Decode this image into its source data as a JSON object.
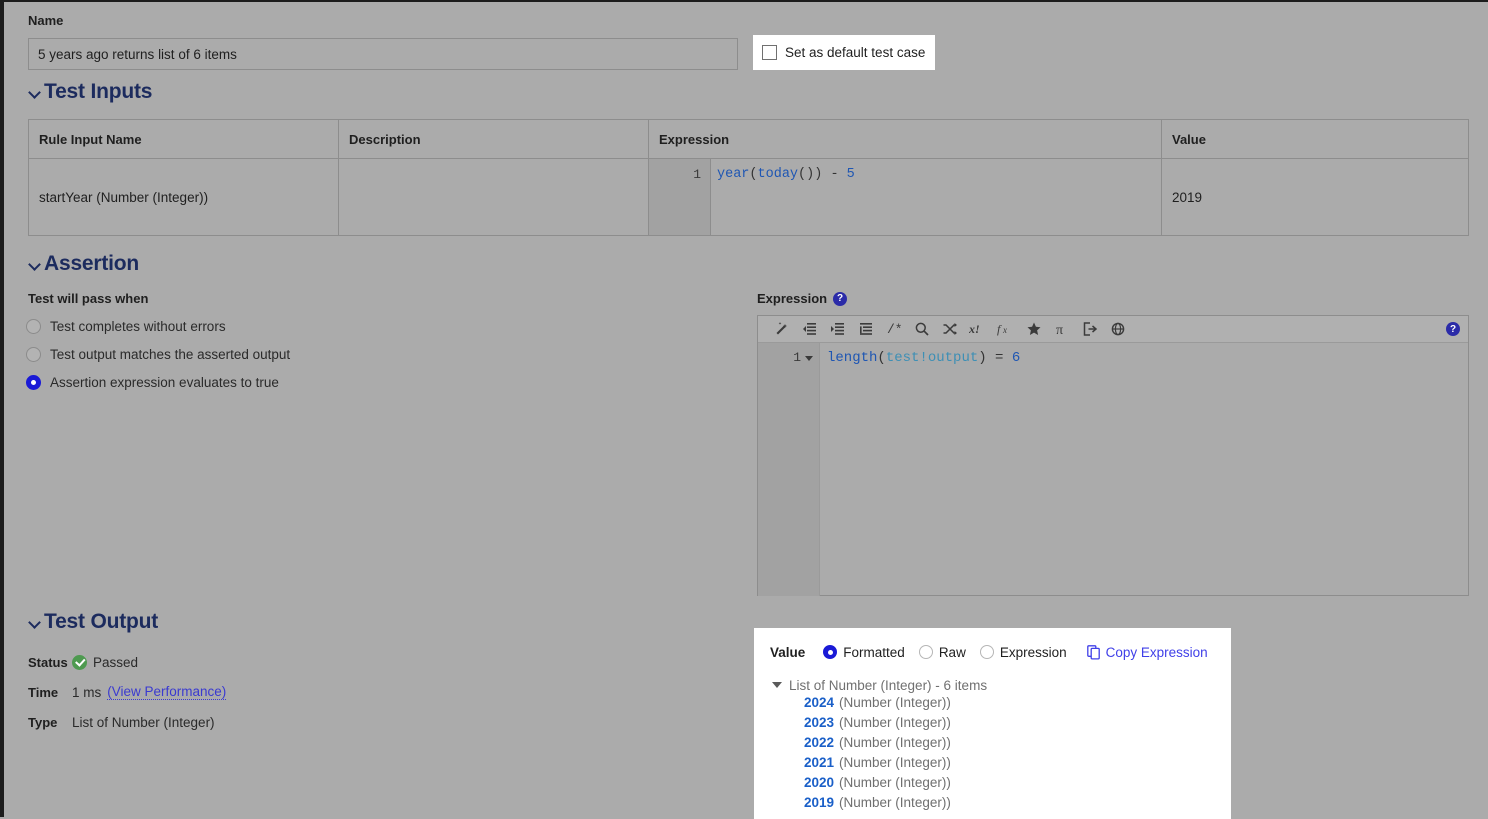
{
  "name_field": {
    "label": "Name",
    "value": "5 years ago returns list of 6 items",
    "placeholder": ""
  },
  "default_test_case": {
    "label": "Set as default test case",
    "checked": false
  },
  "test_inputs": {
    "heading": "Test Inputs",
    "columns": [
      "Rule Input Name",
      "Description",
      "Expression",
      "Value"
    ],
    "rows": [
      {
        "rule_input_name": "startYear (Number (Integer))",
        "description": "",
        "expression_line_number": "1",
        "expression_fn": "year",
        "expression_open": "(",
        "expression_inner_fn": "today",
        "expression_inner_parens": "())",
        "expression_operator": " - ",
        "expression_number": "5",
        "value": "2019"
      }
    ]
  },
  "assertion": {
    "heading": "Assertion",
    "pass_when_label": "Test will pass when",
    "options": [
      {
        "label": "Test completes without errors",
        "selected": false
      },
      {
        "label": "Test output matches the asserted output",
        "selected": false
      },
      {
        "label": "Assertion expression evaluates to true",
        "selected": true
      }
    ],
    "expression": {
      "label": "Expression",
      "help_glyph": "?",
      "line_number": "1",
      "code_fn": "length",
      "code_open": "(",
      "code_var": "test!output",
      "code_close": ")",
      "code_eq": " = ",
      "code_num": "6",
      "toolbar_icons": [
        "format-wand-icon",
        "outdent-icon",
        "indent-icon",
        "list-lines-icon",
        "comment-icon",
        "search-icon",
        "shuffle-icon",
        "variable-bang-icon",
        "function-icon",
        "star-icon",
        "pi-icon",
        "export-icon",
        "globe-link-icon"
      ]
    }
  },
  "test_output": {
    "heading": "Test Output",
    "status_key": "Status",
    "status_value": "Passed",
    "time_key": "Time",
    "time_value": "1 ms",
    "time_link": "(View Performance)",
    "type_key": "Type",
    "type_value": "List of Number (Integer)"
  },
  "value_panel": {
    "title": "Value",
    "modes": [
      {
        "label": "Formatted",
        "selected": true
      },
      {
        "label": "Raw",
        "selected": false
      },
      {
        "label": "Expression",
        "selected": false
      }
    ],
    "copy_label": "Copy Expression",
    "tree_root": "List of Number (Integer) - 6 items",
    "items": [
      {
        "value": "2024",
        "type": "(Number (Integer))"
      },
      {
        "value": "2023",
        "type": "(Number (Integer))"
      },
      {
        "value": "2022",
        "type": "(Number (Integer))"
      },
      {
        "value": "2021",
        "type": "(Number (Integer))"
      },
      {
        "value": "2020",
        "type": "(Number (Integer))"
      },
      {
        "value": "2019",
        "type": "(Number (Integer))"
      }
    ]
  },
  "colors": {
    "background": "#ababab",
    "heading": "#1c2b5e",
    "accent_blue": "#1a1ad6",
    "link": "#4040e8",
    "status_green": "#4e9a50",
    "code_fn": "#1e56b3",
    "code_var": "#3d8fb5"
  }
}
